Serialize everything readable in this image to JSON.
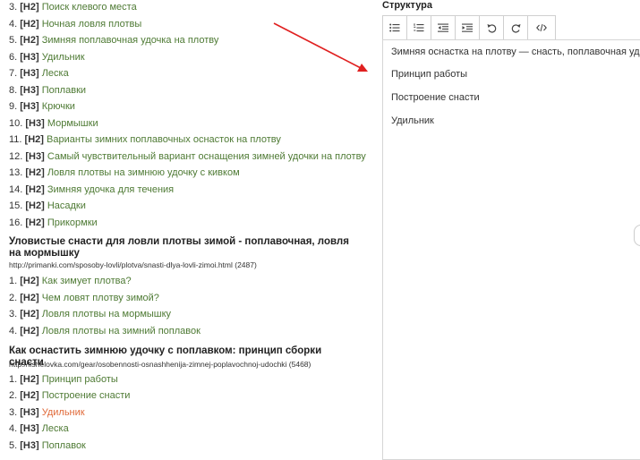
{
  "outline1": [
    {
      "num": "3.",
      "tag": "[H2]",
      "text": "Поиск клевого места"
    },
    {
      "num": "4.",
      "tag": "[H2]",
      "text": "Ночная ловля плотвы"
    },
    {
      "num": "5.",
      "tag": "[H2]",
      "text": "Зимняя поплавочная удочка на плотву"
    },
    {
      "num": "6.",
      "tag": "[H3]",
      "text": "Удильник"
    },
    {
      "num": "7.",
      "tag": "[H3]",
      "text": "Леска"
    },
    {
      "num": "8.",
      "tag": "[H3]",
      "text": "Поплавки"
    },
    {
      "num": "9.",
      "tag": "[H3]",
      "text": "Крючки"
    },
    {
      "num": "10.",
      "tag": "[H3]",
      "text": "Мормышки"
    },
    {
      "num": "11.",
      "tag": "[H2]",
      "text": "Варианты зимних поплавочных оснасток на плотву"
    },
    {
      "num": "12.",
      "tag": "[H3]",
      "text": "Самый чувствительный вариант оснащения зимней удочки на плотву"
    },
    {
      "num": "13.",
      "tag": "[H2]",
      "text": "Ловля плотвы на зимнюю удочку с кивком"
    },
    {
      "num": "14.",
      "tag": "[H2]",
      "text": "Зимняя удочка для течения"
    },
    {
      "num": "15.",
      "tag": "[H2]",
      "text": "Насадки"
    },
    {
      "num": "16.",
      "tag": "[H2]",
      "text": "Прикормки"
    }
  ],
  "source2": {
    "title": "Уловистые снасти для ловли плотвы зимой - поплавочная, ловля на мормышку",
    "url": "http://primanki.com/sposoby-lovli/plotva/snasti-dlya-lovli-zimoi.html (2487)",
    "items": [
      {
        "num": "1.",
        "tag": "[H2]",
        "text": "Как зимует плотва?"
      },
      {
        "num": "2.",
        "tag": "[H2]",
        "text": "Чем ловят плотву зимой?"
      },
      {
        "num": "3.",
        "tag": "[H2]",
        "text": "Ловля плотвы на мормышку"
      },
      {
        "num": "4.",
        "tag": "[H2]",
        "text": "Ловля плотвы на зимний поплавок"
      }
    ]
  },
  "source3": {
    "title": "Как оснастить зимнюю удочку с поплавком: принцип сборки снасти",
    "url": "http://fishelovka.com/gear/osobennosti-osnashhenija-zimnej-poplavochnoj-udochki (5468)",
    "items": [
      {
        "num": "1.",
        "tag": "[H2]",
        "text": "Принцип работы"
      },
      {
        "num": "2.",
        "tag": "[H2]",
        "text": "Построение снасти"
      },
      {
        "num": "3.",
        "tag": "[H3]",
        "text": "Удильник"
      },
      {
        "num": "4.",
        "tag": "[H3]",
        "text": "Леска"
      },
      {
        "num": "5.",
        "tag": "[H3]",
        "text": "Поплавок"
      }
    ]
  },
  "structure": {
    "title": "Структура",
    "toolbar": [
      "bullet-list",
      "numbered-list",
      "outdent",
      "indent",
      "undo",
      "redo",
      "code-view"
    ],
    "lines": [
      "Зимняя оснастка на плотву — снасть, поплавочная удочка",
      "Принцип работы",
      "Построение снасти",
      "Удильник"
    ]
  },
  "colors": {
    "link": "#4e7a34",
    "active_link": "#e06a3a",
    "arrow": "#e02020"
  }
}
